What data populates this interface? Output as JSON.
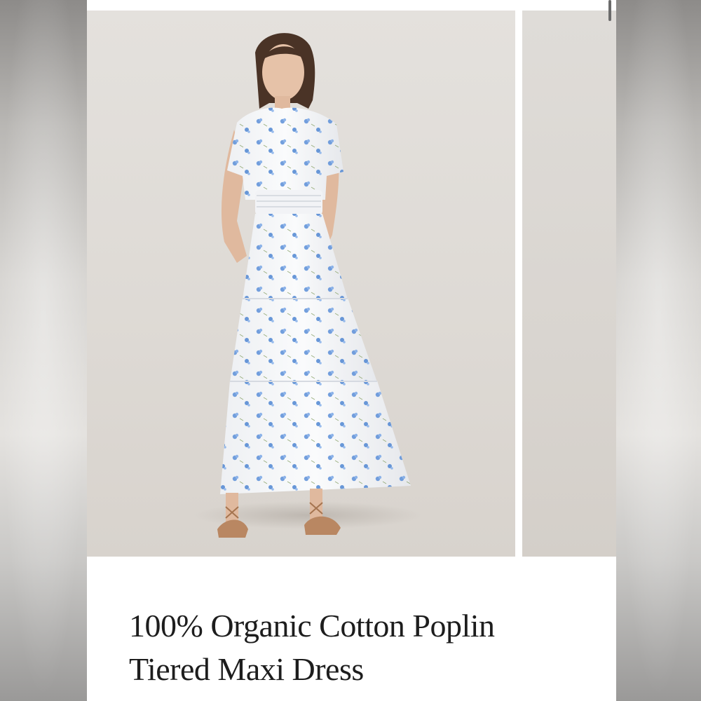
{
  "product": {
    "title_line_1": "100% Organic Cotton Poplin",
    "title_line_2": "Tiered Maxi Dress"
  },
  "gallery": {
    "images": [
      {
        "icon": "model-photo",
        "kind": "main"
      },
      {
        "icon": "model-photo",
        "kind": "next-peek"
      }
    ]
  },
  "colors": {
    "dress": "#f7f8fa",
    "print": "#5b8fd8",
    "background": "#e0ddd9",
    "sandals": "#b98762"
  }
}
